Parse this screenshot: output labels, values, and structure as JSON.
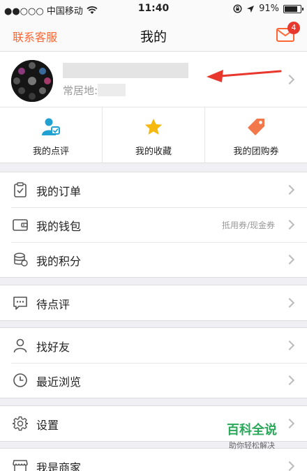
{
  "status": {
    "carrier": "●●○○○ 中国移动",
    "time": "11:40",
    "battery_percent": "91%",
    "battery_level": 0.91
  },
  "nav": {
    "left": "联系客服",
    "title": "我的",
    "badge": "4"
  },
  "profile": {
    "residence": "常居地:"
  },
  "shortcuts": [
    {
      "label": "我的点评",
      "icon": "user-review-icon"
    },
    {
      "label": "我的收藏",
      "icon": "star-icon"
    },
    {
      "label": "我的团购券",
      "icon": "coupon-tag-icon"
    }
  ],
  "group1": [
    {
      "label": "我的订单",
      "sub": "",
      "icon": "order-clipboard-icon"
    },
    {
      "label": "我的钱包",
      "sub": "抵用券/现金券",
      "icon": "wallet-icon"
    },
    {
      "label": "我的积分",
      "sub": "",
      "icon": "points-coins-icon"
    }
  ],
  "group2": [
    {
      "label": "待点评",
      "icon": "comment-bubble-icon"
    }
  ],
  "group3": [
    {
      "label": "找好友",
      "icon": "person-icon"
    },
    {
      "label": "最近浏览",
      "icon": "clock-icon"
    }
  ],
  "group4": [
    {
      "label": "设置",
      "icon": "gear-icon"
    }
  ],
  "group5": [
    {
      "label": "我是商家",
      "icon": "shop-icon"
    }
  ],
  "watermark": {
    "title": "百科全说",
    "subtitle": "助你轻松解决"
  }
}
